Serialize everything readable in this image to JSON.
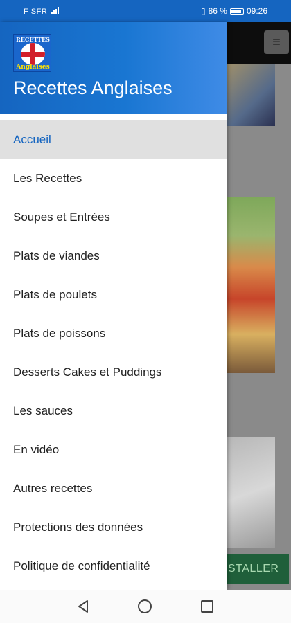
{
  "status_bar": {
    "carrier": "F SFR",
    "battery": "86 %",
    "time": "09:26"
  },
  "drawer": {
    "logo": {
      "top_text": "RECETTES",
      "bottom_text": "Anglaises"
    },
    "title": "Recettes Anglaises",
    "items": [
      {
        "label": "Accueil",
        "active": true
      },
      {
        "label": "Les Recettes"
      },
      {
        "label": "Soupes et Entrées"
      },
      {
        "label": "Plats de viandes"
      },
      {
        "label": "Plats de poulets"
      },
      {
        "label": "Plats de poissons"
      },
      {
        "label": "Desserts Cakes et Puddings"
      },
      {
        "label": "Les sauces"
      },
      {
        "label": "En vidéo"
      },
      {
        "label": "Autres recettes"
      },
      {
        "label": "Protections des données"
      },
      {
        "label": "Politique de confidentialité"
      }
    ]
  },
  "background_app": {
    "menu_icon": "hamburger-icon",
    "install_label": "STALLER"
  },
  "colors": {
    "primary": "#1565c0",
    "active_bg": "#e0e0e0",
    "install_bg": "#1f5f3a"
  }
}
